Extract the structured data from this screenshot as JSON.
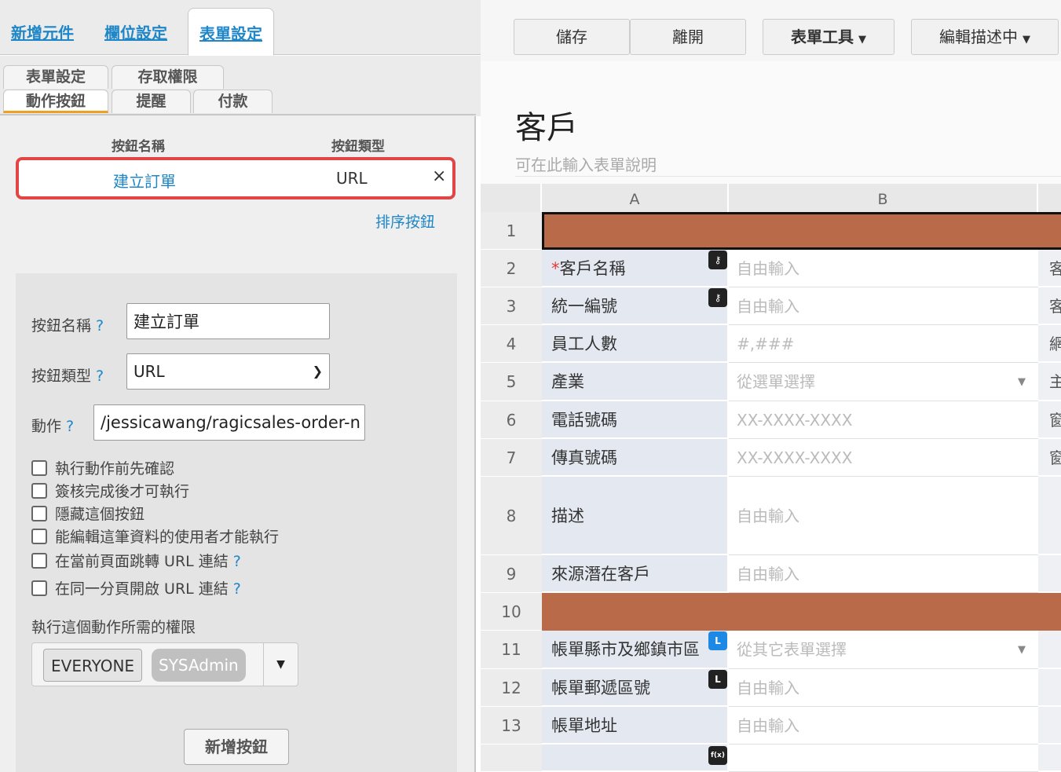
{
  "left_panel": {
    "top_tabs": [
      "新增元件",
      "欄位設定",
      "表單設定"
    ],
    "sub_tabs_row1": [
      "表單設定",
      "存取權限"
    ],
    "sub_tabs_row2": [
      "動作按鈕",
      "提醒",
      "付款"
    ],
    "list_headers": {
      "name": "按鈕名稱",
      "type": "按鈕類型"
    },
    "button_row": {
      "name": "建立訂單",
      "type": "URL",
      "close": "×"
    },
    "sort_link": "排序按鈕",
    "form": {
      "name_label": "按鈕名稱",
      "name_value": "建立訂單",
      "type_label": "按鈕類型",
      "type_value": "URL",
      "action_label": "動作",
      "action_value": "/jessicawang/ragicsales-order-n",
      "help": "?",
      "checkboxes": [
        "執行動作前先確認",
        "簽核完成後才可執行",
        "隱藏這個按鈕",
        "能編輯這筆資料的使用者才能執行",
        "在當前頁面跳轉 URL 連結",
        "在同一分頁開啟 URL 連結"
      ],
      "permission_label": "執行這個動作所需的權限",
      "permission_chips": [
        "EVERYONE",
        "SYSAdmin"
      ],
      "add_button": "新增按鈕"
    }
  },
  "toolbar": {
    "save": "儲存",
    "leave": "離開",
    "form_tools": "表單工具",
    "edit_mode": "編輯描述中"
  },
  "form": {
    "title": "客戶",
    "description_placeholder": "可在此輸入表單說明"
  },
  "sheet": {
    "col_letters": [
      "A",
      "B"
    ],
    "rows": [
      {
        "num": "1",
        "kind": "sep",
        "selected": true
      },
      {
        "num": "2",
        "label": "客戶名稱",
        "required": true,
        "badge": "key",
        "value": "自由輸入",
        "c": "客"
      },
      {
        "num": "3",
        "label": "統一編號",
        "badge": "key",
        "value": "自由輸入",
        "c": "客"
      },
      {
        "num": "4",
        "label": "員工人數",
        "value": "#,###",
        "c": "網"
      },
      {
        "num": "5",
        "label": "產業",
        "value": "從選單選擇",
        "dropdown": true,
        "c": "主"
      },
      {
        "num": "6",
        "label": "電話號碼",
        "value": "XX-XXXX-XXXX",
        "c": "窗"
      },
      {
        "num": "7",
        "label": "傳真號碼",
        "value": "XX-XXXX-XXXX",
        "c": "窗"
      },
      {
        "num": "8",
        "label": "描述",
        "value": "自由輸入",
        "tall": true
      },
      {
        "num": "9",
        "label": "來源潛在客戶",
        "value": "自由輸入"
      },
      {
        "num": "10",
        "kind": "sep"
      },
      {
        "num": "11",
        "label": "帳單縣市及鄉鎮市區",
        "badge": "L-blue",
        "value": "從其它表單選擇",
        "dropdown": true
      },
      {
        "num": "12",
        "label": "帳單郵遞區號",
        "badge": "L-dark",
        "value": "自由輸入"
      },
      {
        "num": "13",
        "label": "帳單地址",
        "value": "自由輸入"
      },
      {
        "num": "",
        "label": "",
        "badge": "fx",
        "value": ""
      }
    ]
  }
}
